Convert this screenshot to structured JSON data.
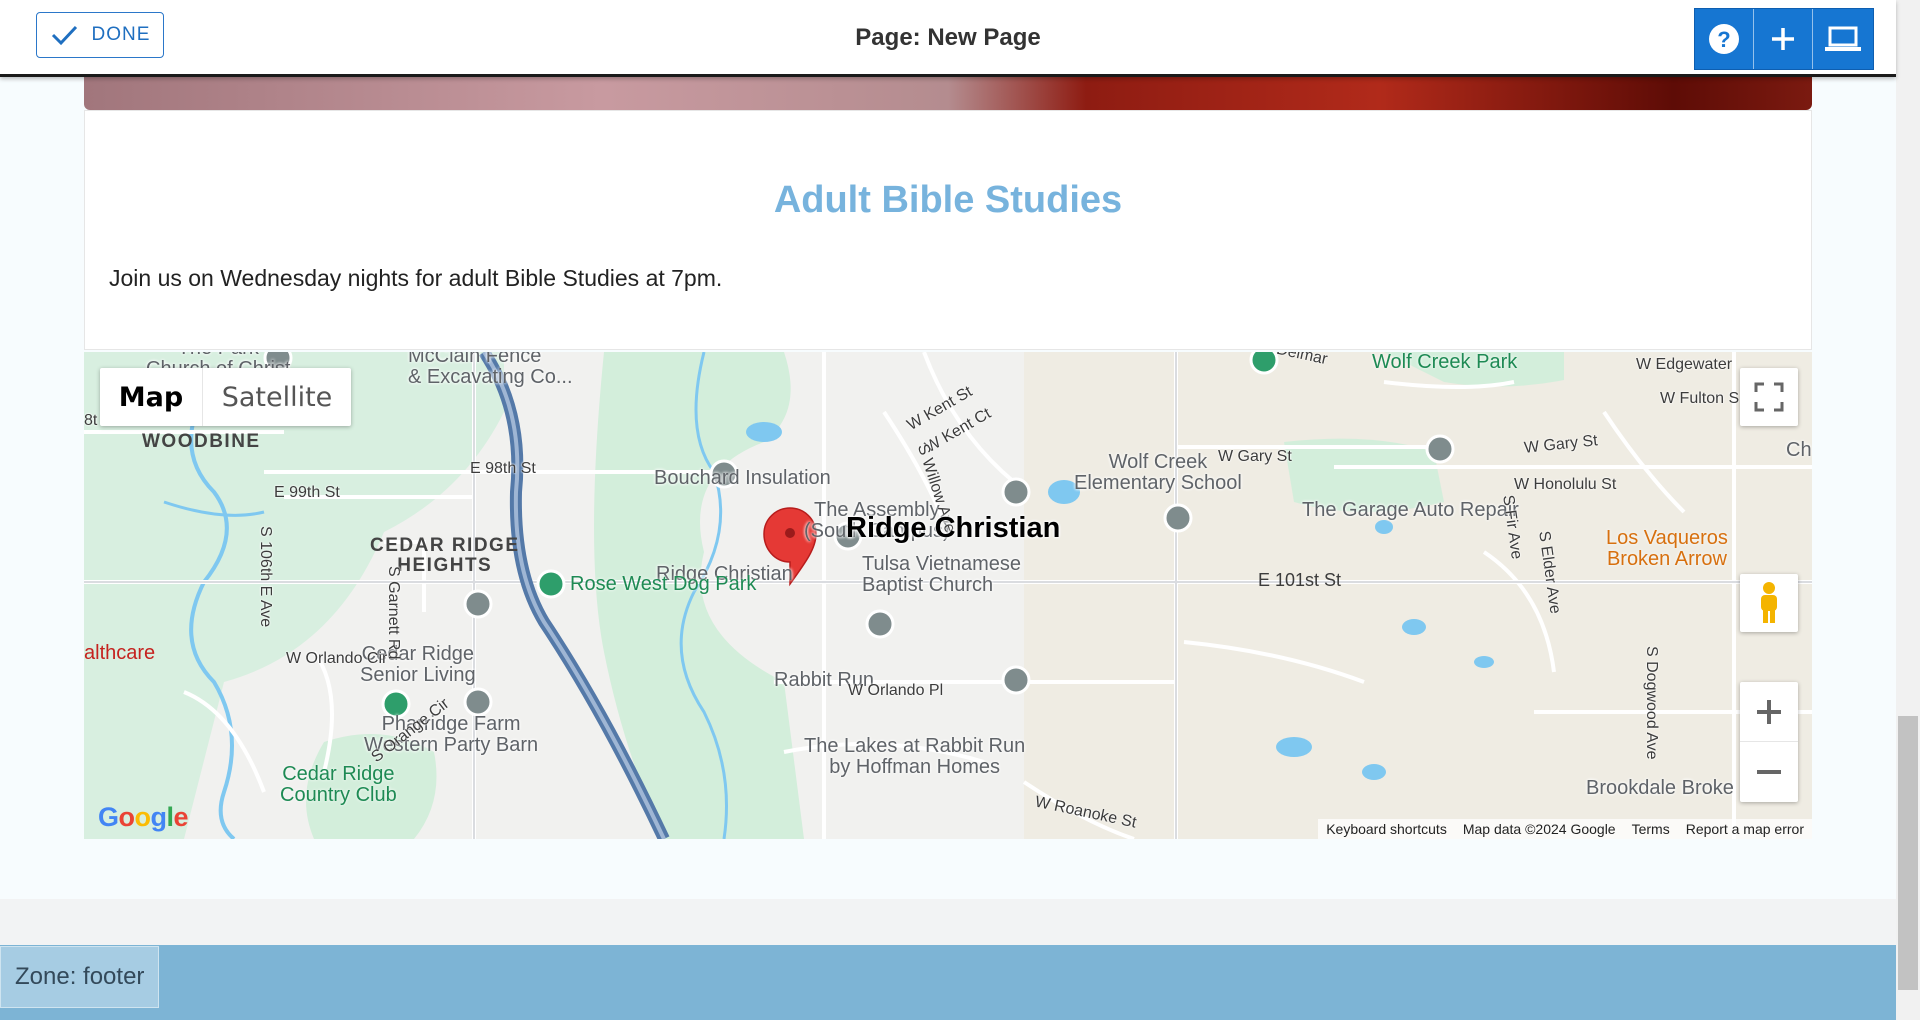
{
  "topbar": {
    "done_label": "DONE",
    "page_title": "Page: New Page",
    "icons": [
      "help-icon",
      "plus-icon",
      "laptop-icon"
    ]
  },
  "section": {
    "title": "Adult Bible Studies",
    "text": "Join us on Wednesday nights for adult Bible Studies at 7pm."
  },
  "map": {
    "map_type_map": "Map",
    "map_type_satellite": "Satellite",
    "marker_label": "Ridge Christian",
    "pois": {
      "bouchard": "Bouchard Insulation",
      "assembly": "The Assembly\n(South Campus)",
      "wolfcreek_school": "Wolf Creek\nElementary School",
      "garage": "The Garage Auto Repair",
      "ridge_small": "Ridge Christian",
      "tulsa_viet": "Tulsa Vietnamese\nBaptist Church",
      "cedar_senior": "Cedar Ridge\nSenior Living",
      "rabbit_run": "Rabbit Run",
      "pharridge": "Pharridge Farm\nWestern Party Barn",
      "lakes": "The Lakes at Rabbit Run\nby Hoffman Homes",
      "brookdale": "Brookdale Broke",
      "mcclain": "McClain Fence\n& Excavating Co...",
      "park_church": "The Park\nChurch of Christ",
      "ch_right": "Ch",
      "healthcare": "althcare",
      "eighth": "8t"
    },
    "parks": {
      "wolf_creek_park": "Wolf Creek Park",
      "rose_west": "Rose West Dog Park",
      "cedar_country": "Cedar Ridge\nCountry Club"
    },
    "restaurant": "Los Vaqueros\nBroken Arrow",
    "areas": {
      "woodbine": "WOODBINE",
      "cedar_heights": "CEDAR RIDGE\nHEIGHTS"
    },
    "streets": {
      "e98": "E 98th St",
      "e99": "E 99th St",
      "s_garnett": "S Garnett Rd",
      "s_106": "S 106th E Ave",
      "w_orlando_cir": "W Orlando Cir",
      "s_orange": "S Orange Cir",
      "w_kent_st": "W Kent St",
      "w_kent_ct": "W Kent Ct",
      "s_willow": "S Willow Ave",
      "w_gary": "W Gary St",
      "w_gary2": "W Gary St",
      "w_honolulu": "W Honolulu St",
      "w_edgewater": "W Edgewater",
      "w_fulton": "W Fulton S",
      "delmar": "Delmar",
      "s_fir": "S Fir Ave",
      "s_elder": "S Elder Ave",
      "e101": "E 101st St",
      "w_orlando_pl": "W Orlando Pl",
      "s_dogwood": "S Dogwood Ave",
      "w_roanoke": "W Roanoke St"
    },
    "google_logo": "Google",
    "attribution": {
      "shortcuts": "Keyboard shortcuts",
      "data": "Map data ©2024 Google",
      "terms": "Terms",
      "report": "Report a map error"
    },
    "colors": {
      "water": "#7fc8f0",
      "park": "#d3eedb",
      "highway": "#5479a8",
      "marker": "#e53935"
    }
  },
  "footer": {
    "zone_label": "Zone: footer"
  },
  "colors": {
    "accent_blue": "#1676d2",
    "title_blue": "#77b3dd",
    "footer_blue": "#7db4d5"
  }
}
